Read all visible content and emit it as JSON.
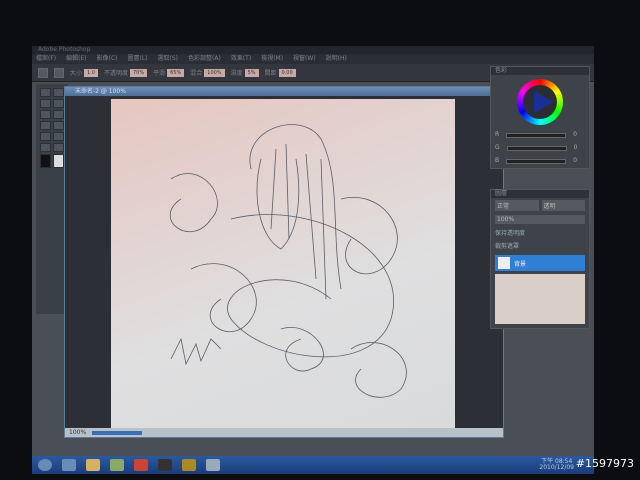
{
  "window": {
    "title": "Adobe Photoshop"
  },
  "menu": [
    "檔案(F)",
    "編輯(E)",
    "影像(C)",
    "圖層(L)",
    "選取(S)",
    "色彩調整(A)",
    "效果(T)",
    "檢視(M)",
    "視窗(W)",
    "說明(H)"
  ],
  "options": [
    {
      "label": "大小",
      "value": "1.0"
    },
    {
      "label": "不透明度",
      "value": "70%"
    },
    {
      "label": "平滑",
      "value": "65%"
    },
    {
      "label": "混合",
      "value": "100%"
    },
    {
      "label": "濕度",
      "value": "5%"
    },
    {
      "label": "間距",
      "value": "0.00"
    }
  ],
  "document": {
    "title": "未命名-2 @ 100%",
    "zoom": "100%",
    "close": "x"
  },
  "color_panel": {
    "title": "色彩",
    "channels": [
      "R",
      "G",
      "B"
    ],
    "values": [
      "0",
      "0",
      "0"
    ]
  },
  "layers_panel": {
    "title": "圖層",
    "mode": "正常",
    "blend": "透明",
    "opacity": "100%",
    "lock1": "保持透明度",
    "lock2": "裁剪遮罩",
    "layer_name": "背景"
  },
  "taskbar": {
    "time": "下午 08:54",
    "date": "2010/12/09"
  },
  "watermark": "#1597973"
}
